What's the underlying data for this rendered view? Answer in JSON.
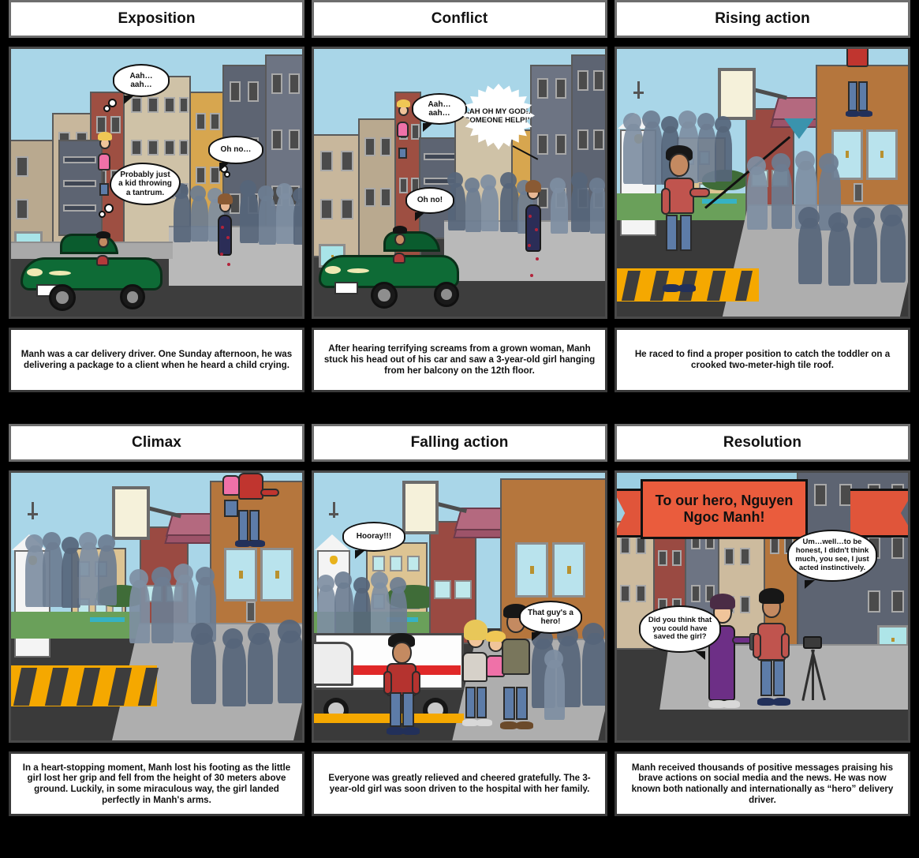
{
  "storyboard": {
    "background_color": "#000000",
    "panel_border_color": "#6e6e6e",
    "rows": 2,
    "columns": 3
  },
  "panels": [
    {
      "id": "exposition",
      "title": "Exposition",
      "caption": "Manh was a car delivery driver. One Sunday afternoon, he was delivering a package to a client when he heard a child crying.",
      "bubbles": [
        {
          "id": "girl-cry",
          "text": "Aah…\naah…"
        },
        {
          "id": "bystander-ohno",
          "text": "Oh no…"
        },
        {
          "id": "driver-thought",
          "text": "Probably just a kid throwing a tantrum."
        }
      ]
    },
    {
      "id": "conflict",
      "title": "Conflict",
      "caption": "After hearing terrifying screams from a grown woman, Manh stuck his head out of his car and saw a 3-year-old girl hanging from her balcony on the 12th floor.",
      "bubbles": [
        {
          "id": "girl-cry",
          "text": "Aah…\naah…"
        },
        {
          "id": "woman-scream",
          "text": "AAH OH MY GOD!!! SOMEONE HELP!!!"
        },
        {
          "id": "driver-ohno",
          "text": "Oh no!"
        }
      ]
    },
    {
      "id": "rising-action",
      "title": "Rising action",
      "caption": "He raced to find a proper position to catch the toddler on a crooked two-meter-high tile roof.",
      "bubbles": []
    },
    {
      "id": "climax",
      "title": "Climax",
      "caption": "In a heart-stopping moment, Manh lost his footing as the little girl lost her grip and fell from the height of 30 meters above ground. Luckily, in some miraculous way, the girl landed perfectly in Manh's arms.",
      "bubbles": []
    },
    {
      "id": "falling-action",
      "title": "Falling action",
      "caption": "Everyone was greatly relieved and cheered gratefully. The 3-year-old girl was soon driven to the hospital with her family.",
      "bubbles": [
        {
          "id": "crowd-hooray",
          "text": "Hooray!!!"
        },
        {
          "id": "onlooker-hero",
          "text": "That guy's a hero!"
        }
      ]
    },
    {
      "id": "resolution",
      "title": "Resolution",
      "caption": "Manh received thousands of positive messages praising his brave actions on social media and the news. He was now known both nationally and internationally as “hero” delivery driver.",
      "banner": {
        "text": "To our hero, Nguyen Ngoc Manh!",
        "color": "#ea5c3d"
      },
      "bubbles": [
        {
          "id": "reporter-question",
          "text": "Did you think that you could have saved the girl?"
        },
        {
          "id": "hero-answer",
          "text": "Um…well…to be honest, I didn't think much, you see, I just acted instinctively."
        }
      ]
    }
  ]
}
